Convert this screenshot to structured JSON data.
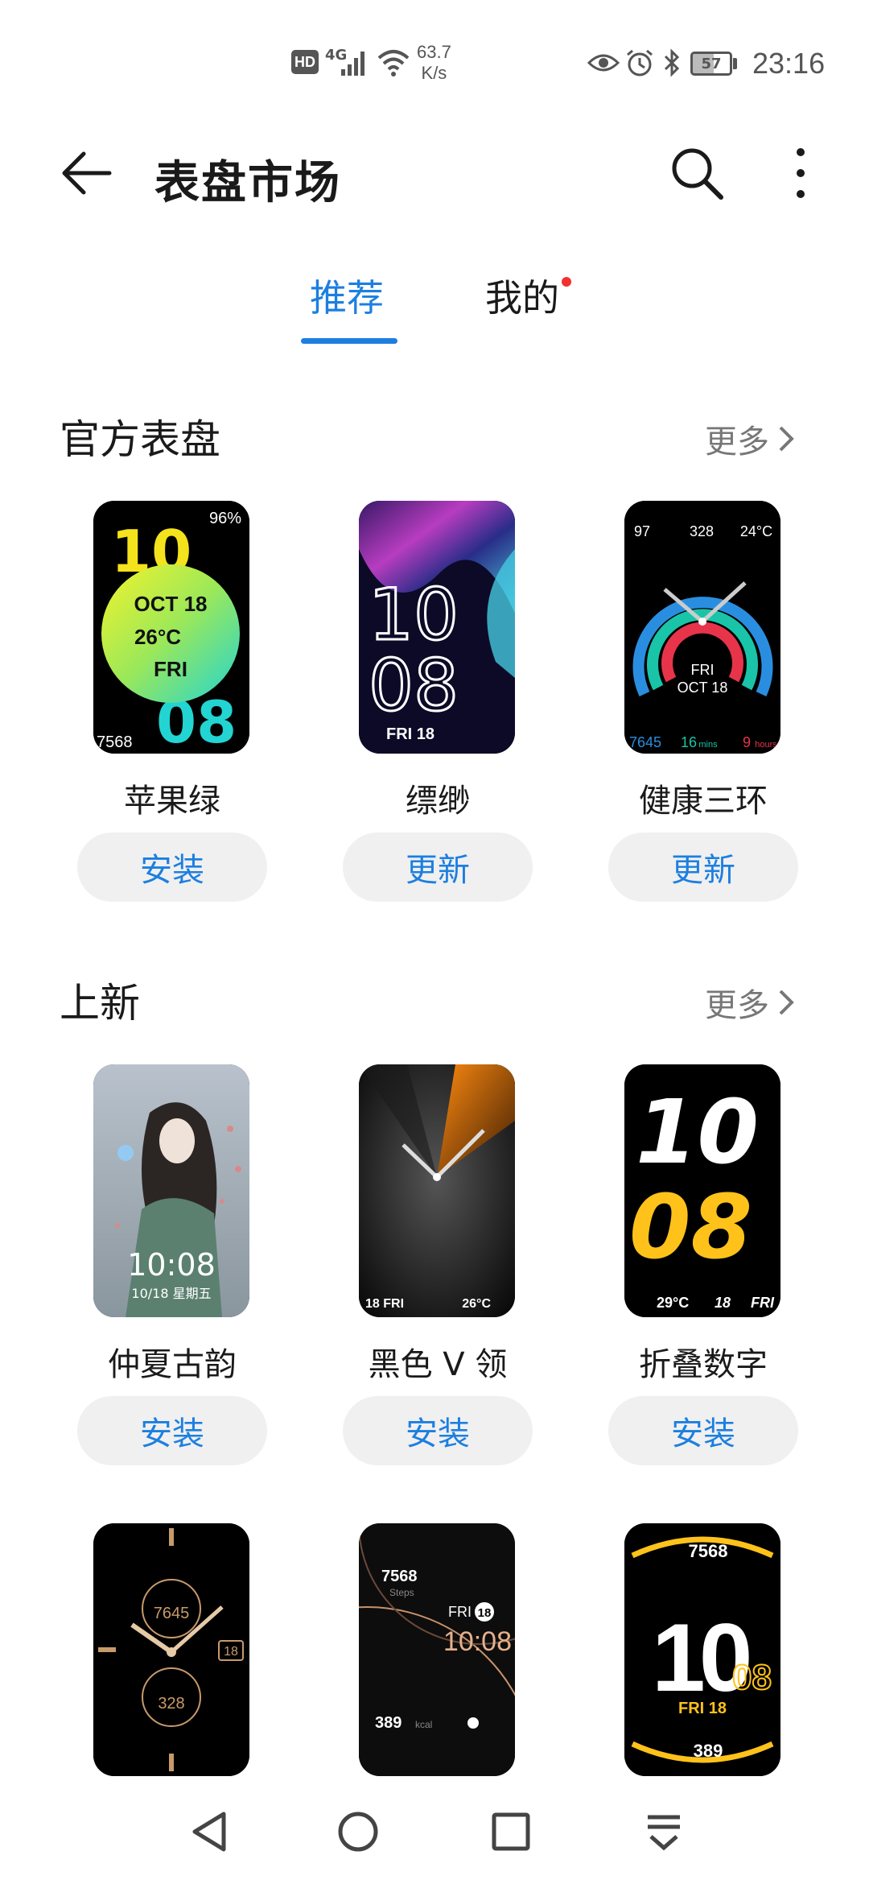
{
  "status_bar": {
    "hd": "HD",
    "network": "4G",
    "speed_value": "63.7",
    "speed_unit": "K/s",
    "battery": "57",
    "time": "23:16"
  },
  "app_bar": {
    "title": "表盘市场"
  },
  "tabs": [
    {
      "label": "推荐"
    },
    {
      "label": "我的"
    }
  ],
  "sections": [
    {
      "title": "官方表盘",
      "more": "更多",
      "items": [
        {
          "name": "苹果绿",
          "action": "安装",
          "face": {
            "top_big": "10",
            "bottom_big": "08",
            "date": "OCT 18",
            "temp": "26°C",
            "day": "FRI",
            "battery": "96%",
            "steps": "7568"
          }
        },
        {
          "name": "缥缈",
          "action": "更新",
          "face": {
            "hour": "10",
            "minute": "08",
            "date": "FRI 18"
          }
        },
        {
          "name": "健康三环",
          "action": "更新",
          "face": {
            "heart": "97",
            "cal": "328",
            "temp": "24°C",
            "day": "FRI",
            "date": "OCT 18",
            "steps": "7645",
            "mins": "16",
            "mins_unit": "mins",
            "hours": "9",
            "hours_unit": "hours"
          }
        }
      ]
    },
    {
      "title": "上新",
      "more": "更多",
      "items": [
        {
          "name": "仲夏古韵",
          "action": "安装",
          "face": {
            "time": "10:08",
            "date": "10/18 星期五"
          }
        },
        {
          "name": "黑色 V 领",
          "action": "安装",
          "face": {
            "date": "18 FRI",
            "temp": "26°C"
          }
        },
        {
          "name": "折叠数字",
          "action": "安装",
          "face": {
            "hour": "10",
            "minute": "08",
            "temp": "29°C",
            "date": "18",
            "day": "FRI"
          }
        }
      ]
    }
  ],
  "third_row": [
    {
      "face": {
        "steps": "7645",
        "cal": "328",
        "date": "18"
      }
    },
    {
      "face": {
        "steps": "7568",
        "steps_label": "Steps",
        "day": "FRI",
        "date": "18",
        "time": "10:08",
        "kcal": "389",
        "kcal_unit": "kcal"
      }
    },
    {
      "face": {
        "steps": "7568",
        "hour": "10",
        "minute": "08",
        "date": "FRI 18",
        "cal": "389"
      }
    }
  ],
  "colors": {
    "accent": "#1c7fe0",
    "badge": "#f23030",
    "button_bg": "#f0f0f0"
  }
}
